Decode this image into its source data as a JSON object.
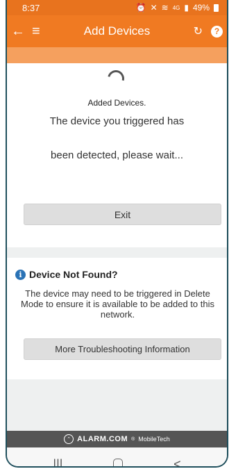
{
  "status_bar": {
    "time": "8:37",
    "signal_text": "4G",
    "battery_percent": "49%",
    "icons": [
      "alarm-icon",
      "mute-icon",
      "wifi-icon",
      "signal-icon",
      "battery-icon"
    ]
  },
  "header": {
    "title": "Add Devices",
    "back_icon": "←",
    "menu_icon": "≡",
    "refresh_icon": "↻",
    "help_icon": "?"
  },
  "main": {
    "added_label": "Added Devices.",
    "message_line1": "The device you triggered has",
    "message_line2": "been detected, please wait...",
    "exit_label": "Exit"
  },
  "troubleshoot": {
    "title": "Device Not Found?",
    "info_icon": "i",
    "body": "The device may need to be triggered in Delete Mode to ensure it is available to be added to this network.",
    "more_label": "More Troubleshooting Information"
  },
  "footer": {
    "brand_name": "ALARM.COM",
    "brand_mark": "®",
    "brand_sub": "MobileTech"
  },
  "nav": {
    "recents_icon": "|||",
    "back_icon": "<"
  },
  "colors": {
    "accent": "#f07a22",
    "status_bar": "#e8731e",
    "band": "#f5a05e",
    "info_blue": "#2a72b5"
  }
}
